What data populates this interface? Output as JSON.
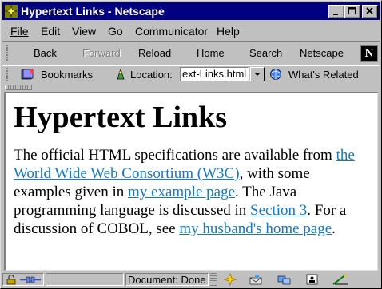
{
  "window": {
    "title": "Hypertext Links - Netscape"
  },
  "menu": [
    "File",
    "Edit",
    "View",
    "Go",
    "Communicator",
    "Help"
  ],
  "navigation": {
    "back": "Back",
    "forward": "Forward",
    "reload": "Reload",
    "home": "Home",
    "search": "Search",
    "netscape": "Netscape",
    "logo_letter": "N"
  },
  "location_bar": {
    "bookmarks": "Bookmarks",
    "location_label": "Location:",
    "url_value": "ext-Links.html",
    "whats_related": "What's Related"
  },
  "page": {
    "heading": "Hypertext Links",
    "p1": "The official HTML specifications are available from ",
    "link1": "the World Wide Web Consortium (W3C)",
    "p2": ", with some examples given in ",
    "link2": "my example page",
    "p3": ". The Java programming language is discussed in ",
    "link3": "Section 3",
    "p4": ". For a discussion of COBOL, see ",
    "link4": "my husband's home page",
    "p5": "."
  },
  "status": {
    "text": "Document: Done"
  },
  "colors": {
    "title_bar": "#000080",
    "link": "#1478c8",
    "chrome": "#c0c0c0"
  }
}
